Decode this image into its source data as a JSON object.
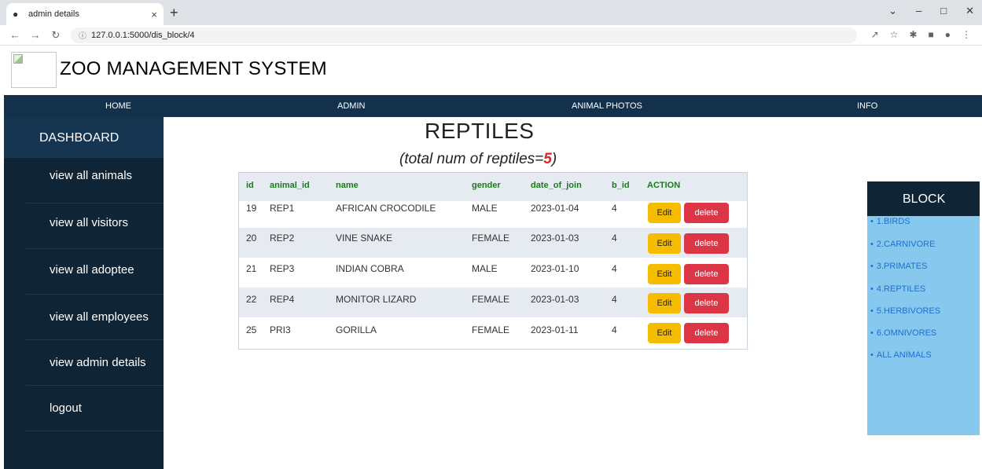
{
  "browser": {
    "tab_title": "admin details",
    "tab_close": "×",
    "new_tab": "+",
    "url": "127.0.0.1:5000/dis_block/4"
  },
  "header": {
    "title": "ZOO MANAGEMENT SYSTEM"
  },
  "nav": {
    "home": "HOME",
    "admin": "ADMIN",
    "animal_photos": "ANIMAL PHOTOS",
    "info": "INFO"
  },
  "sidebar": {
    "dashboard": "DASHBOARD",
    "items": [
      {
        "label": "view all animals"
      },
      {
        "label": "view all visitors"
      },
      {
        "label": "view all adoptee"
      },
      {
        "label": "view all employees"
      },
      {
        "label": "view admin details"
      },
      {
        "label": "logout"
      }
    ]
  },
  "main": {
    "title": "REPTILES",
    "subtitle_prefix": "(total num of reptiles=",
    "count": "5",
    "subtitle_suffix": ")"
  },
  "table": {
    "headers": [
      "id",
      "animal_id",
      "name",
      "gender",
      "date_of_join",
      "b_id",
      "ACTION"
    ],
    "edit_label": "Edit",
    "delete_label": "delete",
    "rows": [
      {
        "id": "19",
        "animal_id": "REP1",
        "name": "AFRICAN CROCODILE",
        "gender": "MALE",
        "date_of_join": "2023-01-04",
        "b_id": "4"
      },
      {
        "id": "20",
        "animal_id": "REP2",
        "name": "VINE SNAKE",
        "gender": "FEMALE",
        "date_of_join": "2023-01-03",
        "b_id": "4"
      },
      {
        "id": "21",
        "animal_id": "REP3",
        "name": "INDIAN COBRA",
        "gender": "MALE",
        "date_of_join": "2023-01-10",
        "b_id": "4"
      },
      {
        "id": "22",
        "animal_id": "REP4",
        "name": "MONITOR LIZARD",
        "gender": "FEMALE",
        "date_of_join": "2023-01-03",
        "b_id": "4"
      },
      {
        "id": "25",
        "animal_id": "PRI3",
        "name": "GORILLA",
        "gender": "FEMALE",
        "date_of_join": "2023-01-11",
        "b_id": "4"
      }
    ]
  },
  "block": {
    "title": "BLOCK",
    "items": [
      "1.BIRDS",
      "2.CARNIVORE",
      "3.PRIMATES",
      "4.REPTILES",
      "5.HERBIVORES",
      "6.OMNIVORES",
      "ALL ANIMALS"
    ]
  },
  "colors": {
    "nav_bg": "#13314a",
    "sidebar_bg": "#0f2434",
    "block_bg": "#86c8ee",
    "edit_button": "#f5bc00",
    "delete_button": "#dc3545",
    "count_red": "#d8262e",
    "header_green": "#1c7a1c"
  }
}
